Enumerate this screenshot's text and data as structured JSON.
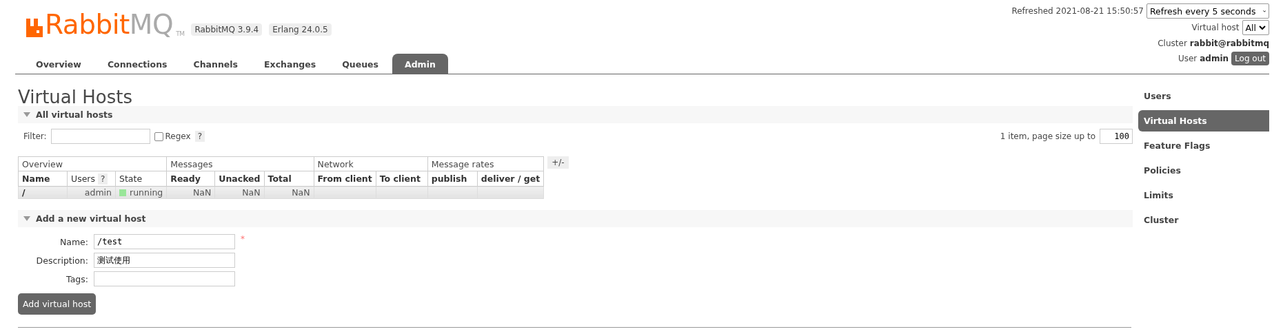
{
  "logo": {
    "brand": "Rabbit",
    "suffix": "MQ",
    "tm": "TM"
  },
  "versions": [
    "RabbitMQ 3.9.4",
    "Erlang 24.0.5"
  ],
  "tabs": [
    {
      "label": "Overview",
      "selected": false
    },
    {
      "label": "Connections",
      "selected": false
    },
    {
      "label": "Channels",
      "selected": false
    },
    {
      "label": "Exchanges",
      "selected": false
    },
    {
      "label": "Queues",
      "selected": false
    },
    {
      "label": "Admin",
      "selected": true
    }
  ],
  "header_right": {
    "refreshed": "Refreshed 2021-08-21 15:50:57",
    "refresh_select": "Refresh every 5 seconds",
    "vhost_label": "Virtual host",
    "vhost_select": "All",
    "cluster_label": "Cluster",
    "cluster": "rabbit@rabbitmq",
    "user_label": "User",
    "user": "admin",
    "logout": "Log out"
  },
  "page_title": "Virtual Hosts",
  "sections": [
    {
      "title": "All virtual hosts",
      "expanded": true
    },
    {
      "title": "Add a new virtual host",
      "expanded": true
    }
  ],
  "filter": {
    "label": "Filter:",
    "regex_label": "Regex",
    "regex_checked": false,
    "help": "?",
    "count": "1 item, page size up to",
    "page_size": "100"
  },
  "table": {
    "groups": [
      {
        "label": "Overview"
      },
      {
        "label": "Messages"
      },
      {
        "label": "Network"
      },
      {
        "label": "Message rates"
      }
    ],
    "toggle": "+/-",
    "columns": [
      {
        "label": "Name"
      },
      {
        "label": "Users",
        "help": "?"
      },
      {
        "label": "State"
      },
      {
        "label": "Ready"
      },
      {
        "label": "Unacked"
      },
      {
        "label": "Total"
      },
      {
        "label": "From client"
      },
      {
        "label": "To client"
      },
      {
        "label": "publish"
      },
      {
        "label": "deliver / get"
      }
    ],
    "rows": [
      {
        "name": "/",
        "users": "admin",
        "state": "running",
        "color": "#99e699",
        "ready": "NaN",
        "unacked": "NaN",
        "total": "NaN"
      }
    ]
  },
  "form": {
    "fields": [
      {
        "label": "Name:",
        "value": "/test",
        "required": true
      },
      {
        "label": "Description:",
        "value": "测试使用",
        "required": false
      },
      {
        "label": "Tags:",
        "required": false
      }
    ],
    "required_mark": "*",
    "submit": "Add virtual host"
  },
  "sidebar": {
    "items": [
      {
        "label": "Users",
        "selected": false
      },
      {
        "label": "Virtual Hosts",
        "selected": true
      },
      {
        "label": "Feature Flags",
        "selected": false
      },
      {
        "label": "Policies",
        "selected": false
      },
      {
        "label": "Limits",
        "selected": false
      },
      {
        "label": "Cluster",
        "selected": false
      }
    ]
  }
}
